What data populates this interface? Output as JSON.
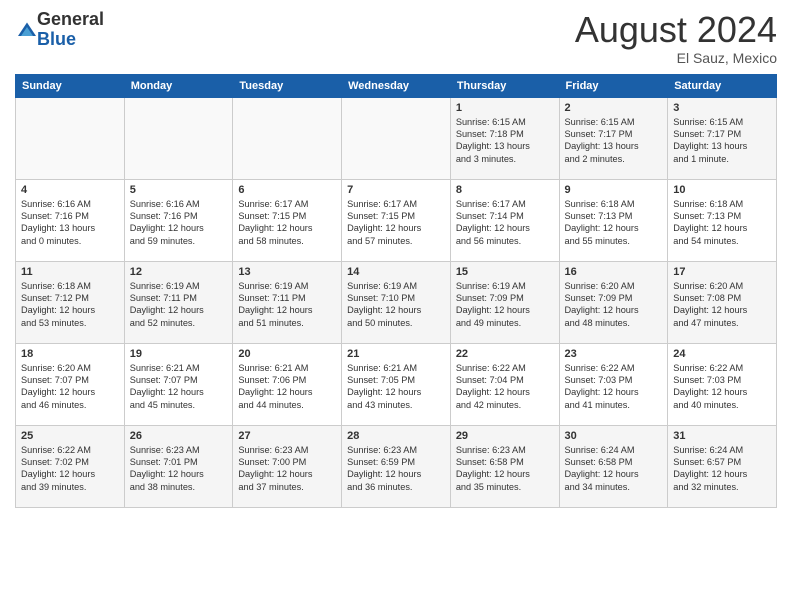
{
  "logo": {
    "general": "General",
    "blue": "Blue"
  },
  "header": {
    "month": "August 2024",
    "location": "El Sauz, Mexico"
  },
  "weekdays": [
    "Sunday",
    "Monday",
    "Tuesday",
    "Wednesday",
    "Thursday",
    "Friday",
    "Saturday"
  ],
  "weeks": [
    [
      {
        "day": "",
        "info": ""
      },
      {
        "day": "",
        "info": ""
      },
      {
        "day": "",
        "info": ""
      },
      {
        "day": "",
        "info": ""
      },
      {
        "day": "1",
        "info": "Sunrise: 6:15 AM\nSunset: 7:18 PM\nDaylight: 13 hours\nand 3 minutes."
      },
      {
        "day": "2",
        "info": "Sunrise: 6:15 AM\nSunset: 7:17 PM\nDaylight: 13 hours\nand 2 minutes."
      },
      {
        "day": "3",
        "info": "Sunrise: 6:15 AM\nSunset: 7:17 PM\nDaylight: 13 hours\nand 1 minute."
      }
    ],
    [
      {
        "day": "4",
        "info": "Sunrise: 6:16 AM\nSunset: 7:16 PM\nDaylight: 13 hours\nand 0 minutes."
      },
      {
        "day": "5",
        "info": "Sunrise: 6:16 AM\nSunset: 7:16 PM\nDaylight: 12 hours\nand 59 minutes."
      },
      {
        "day": "6",
        "info": "Sunrise: 6:17 AM\nSunset: 7:15 PM\nDaylight: 12 hours\nand 58 minutes."
      },
      {
        "day": "7",
        "info": "Sunrise: 6:17 AM\nSunset: 7:15 PM\nDaylight: 12 hours\nand 57 minutes."
      },
      {
        "day": "8",
        "info": "Sunrise: 6:17 AM\nSunset: 7:14 PM\nDaylight: 12 hours\nand 56 minutes."
      },
      {
        "day": "9",
        "info": "Sunrise: 6:18 AM\nSunset: 7:13 PM\nDaylight: 12 hours\nand 55 minutes."
      },
      {
        "day": "10",
        "info": "Sunrise: 6:18 AM\nSunset: 7:13 PM\nDaylight: 12 hours\nand 54 minutes."
      }
    ],
    [
      {
        "day": "11",
        "info": "Sunrise: 6:18 AM\nSunset: 7:12 PM\nDaylight: 12 hours\nand 53 minutes."
      },
      {
        "day": "12",
        "info": "Sunrise: 6:19 AM\nSunset: 7:11 PM\nDaylight: 12 hours\nand 52 minutes."
      },
      {
        "day": "13",
        "info": "Sunrise: 6:19 AM\nSunset: 7:11 PM\nDaylight: 12 hours\nand 51 minutes."
      },
      {
        "day": "14",
        "info": "Sunrise: 6:19 AM\nSunset: 7:10 PM\nDaylight: 12 hours\nand 50 minutes."
      },
      {
        "day": "15",
        "info": "Sunrise: 6:19 AM\nSunset: 7:09 PM\nDaylight: 12 hours\nand 49 minutes."
      },
      {
        "day": "16",
        "info": "Sunrise: 6:20 AM\nSunset: 7:09 PM\nDaylight: 12 hours\nand 48 minutes."
      },
      {
        "day": "17",
        "info": "Sunrise: 6:20 AM\nSunset: 7:08 PM\nDaylight: 12 hours\nand 47 minutes."
      }
    ],
    [
      {
        "day": "18",
        "info": "Sunrise: 6:20 AM\nSunset: 7:07 PM\nDaylight: 12 hours\nand 46 minutes."
      },
      {
        "day": "19",
        "info": "Sunrise: 6:21 AM\nSunset: 7:07 PM\nDaylight: 12 hours\nand 45 minutes."
      },
      {
        "day": "20",
        "info": "Sunrise: 6:21 AM\nSunset: 7:06 PM\nDaylight: 12 hours\nand 44 minutes."
      },
      {
        "day": "21",
        "info": "Sunrise: 6:21 AM\nSunset: 7:05 PM\nDaylight: 12 hours\nand 43 minutes."
      },
      {
        "day": "22",
        "info": "Sunrise: 6:22 AM\nSunset: 7:04 PM\nDaylight: 12 hours\nand 42 minutes."
      },
      {
        "day": "23",
        "info": "Sunrise: 6:22 AM\nSunset: 7:03 PM\nDaylight: 12 hours\nand 41 minutes."
      },
      {
        "day": "24",
        "info": "Sunrise: 6:22 AM\nSunset: 7:03 PM\nDaylight: 12 hours\nand 40 minutes."
      }
    ],
    [
      {
        "day": "25",
        "info": "Sunrise: 6:22 AM\nSunset: 7:02 PM\nDaylight: 12 hours\nand 39 minutes."
      },
      {
        "day": "26",
        "info": "Sunrise: 6:23 AM\nSunset: 7:01 PM\nDaylight: 12 hours\nand 38 minutes."
      },
      {
        "day": "27",
        "info": "Sunrise: 6:23 AM\nSunset: 7:00 PM\nDaylight: 12 hours\nand 37 minutes."
      },
      {
        "day": "28",
        "info": "Sunrise: 6:23 AM\nSunset: 6:59 PM\nDaylight: 12 hours\nand 36 minutes."
      },
      {
        "day": "29",
        "info": "Sunrise: 6:23 AM\nSunset: 6:58 PM\nDaylight: 12 hours\nand 35 minutes."
      },
      {
        "day": "30",
        "info": "Sunrise: 6:24 AM\nSunset: 6:58 PM\nDaylight: 12 hours\nand 34 minutes."
      },
      {
        "day": "31",
        "info": "Sunrise: 6:24 AM\nSunset: 6:57 PM\nDaylight: 12 hours\nand 32 minutes."
      }
    ]
  ]
}
